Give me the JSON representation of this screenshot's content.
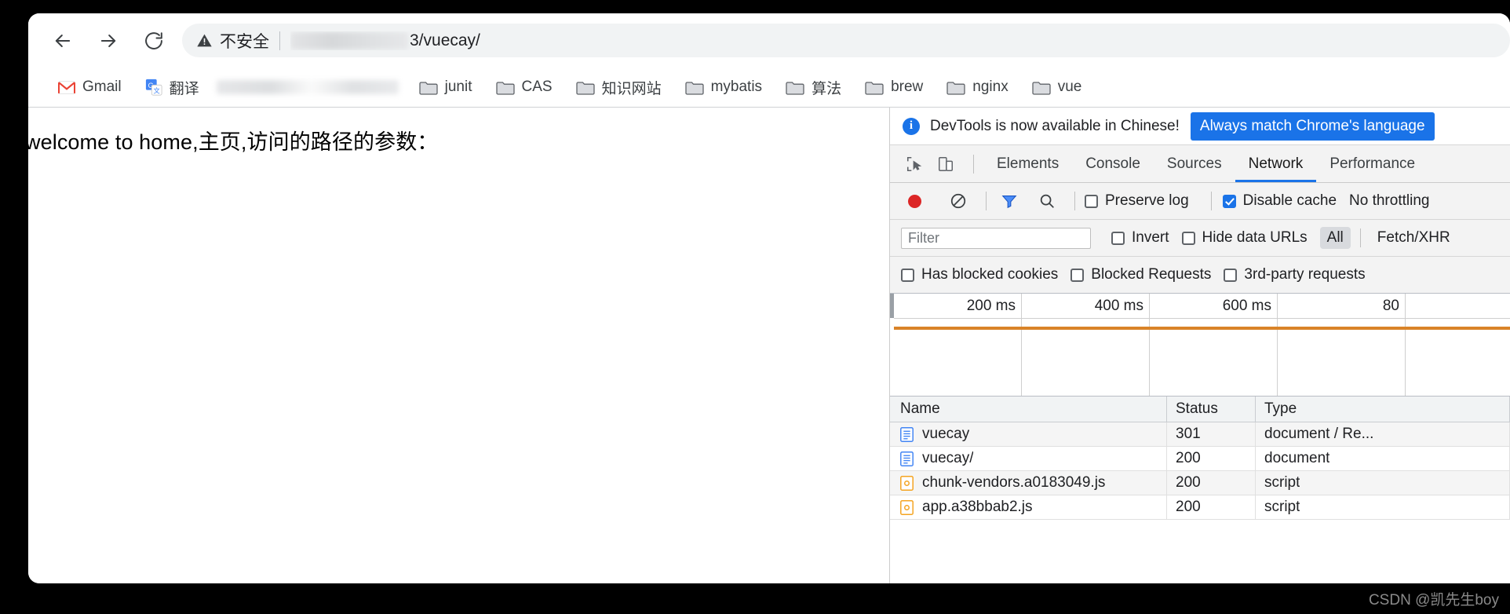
{
  "browser": {
    "nav": {
      "back_label": "Back",
      "forward_label": "Forward",
      "reload_label": "Reload"
    },
    "omnibox": {
      "security_label": "不安全",
      "security_icon": "warning-triangle-icon",
      "url_visible": "3/vuecay/",
      "url_redacted": true
    },
    "bookmarks": [
      {
        "label": "Gmail",
        "icon": "gmail-icon"
      },
      {
        "label": "翻译",
        "icon": "google-translate-icon"
      },
      {
        "label": "",
        "icon": "redacted",
        "redacted": true
      },
      {
        "label": "junit",
        "icon": "folder-icon"
      },
      {
        "label": "CAS",
        "icon": "folder-icon"
      },
      {
        "label": "知识网站",
        "icon": "folder-icon"
      },
      {
        "label": "mybatis",
        "icon": "folder-icon"
      },
      {
        "label": "算法",
        "icon": "folder-icon"
      },
      {
        "label": "brew",
        "icon": "folder-icon"
      },
      {
        "label": "nginx",
        "icon": "folder-icon"
      },
      {
        "label": "vue",
        "icon": "folder-icon"
      }
    ]
  },
  "page": {
    "body_text": "welcome to home,主页,访问的路径的参数："
  },
  "devtools": {
    "infobar": {
      "icon": "info-icon",
      "message": "DevTools is now available in Chinese!",
      "button_label": "Always match Chrome's language"
    },
    "tabs": {
      "inspect_icon": "inspect-cursor-icon",
      "device_icon": "device-toolbar-icon",
      "items": [
        {
          "label": "Elements",
          "active": false
        },
        {
          "label": "Console",
          "active": false
        },
        {
          "label": "Sources",
          "active": false
        },
        {
          "label": "Network",
          "active": true
        },
        {
          "label": "Performance",
          "active": false
        }
      ]
    },
    "network_toolbar": {
      "record_icon": "record-dot-icon",
      "clear_icon": "clear-no-entry-icon",
      "filter_icon": "filter-funnel-icon",
      "search_icon": "search-icon",
      "preserve_log_label": "Preserve log",
      "preserve_log_checked": false,
      "disable_cache_label": "Disable cache",
      "disable_cache_checked": true,
      "throttling_label": "No throttling"
    },
    "filter_row": {
      "filter_placeholder": "Filter",
      "filter_value": "",
      "invert_label": "Invert",
      "invert_checked": false,
      "hide_data_urls_label": "Hide data URLs",
      "hide_data_urls_checked": false,
      "types": [
        {
          "label": "All",
          "selected": true
        },
        {
          "label": "Fetch/XHR",
          "selected": false
        }
      ]
    },
    "options_row": {
      "has_blocked_cookies_label": "Has blocked cookies",
      "has_blocked_cookies_checked": false,
      "blocked_requests_label": "Blocked Requests",
      "blocked_requests_checked": false,
      "third_party_label": "3rd-party requests",
      "third_party_checked": false
    },
    "overview": {
      "ticks": [
        "200 ms",
        "400 ms",
        "600 ms",
        "80"
      ],
      "band_color": "#d98328"
    },
    "requests": {
      "columns": [
        "Name",
        "Status",
        "Type"
      ],
      "rows": [
        {
          "name": "vuecay",
          "status": "301",
          "type": "document / Re...",
          "icon": "document-icon"
        },
        {
          "name": "vuecay/",
          "status": "200",
          "type": "document",
          "icon": "document-icon"
        },
        {
          "name": "chunk-vendors.a0183049.js",
          "status": "200",
          "type": "script",
          "icon": "script-icon"
        },
        {
          "name": "app.a38bbab2.js",
          "status": "200",
          "type": "script",
          "icon": "script-icon"
        }
      ]
    }
  },
  "watermark": {
    "text": "CSDN @凯先生boy"
  },
  "colors": {
    "accent_blue": "#1a73e8",
    "record_red": "#dc2626",
    "timeline_orange": "#d98328"
  }
}
